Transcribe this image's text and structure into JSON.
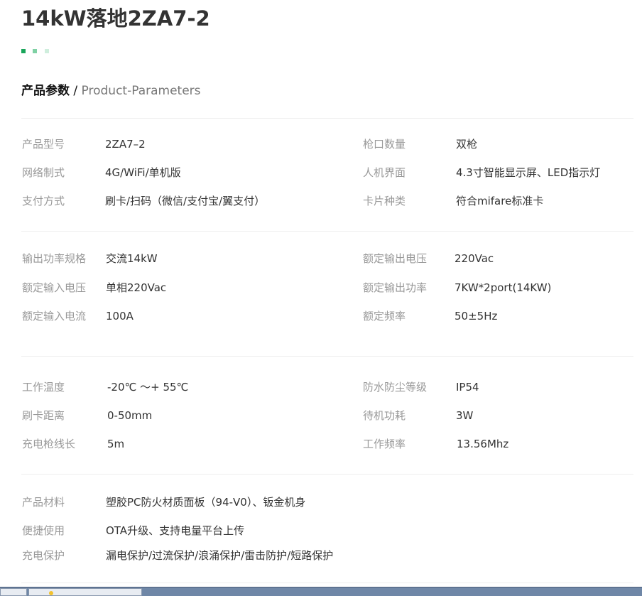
{
  "page": {
    "title": "14kW落地2ZA7-2",
    "accent_colors": [
      "#19a55a",
      "#7fd1a4",
      "#cfeedd"
    ]
  },
  "section": {
    "heading_zh": "产品参数",
    "separator": " / ",
    "heading_en": "Product-Parameters"
  },
  "groups": [
    {
      "rows": [
        {
          "left_label": "产品型号",
          "left_value": "2ZA7–2",
          "right_label": "枪口数量",
          "right_value": "双枪"
        },
        {
          "left_label": "网络制式",
          "left_value": "4G/WiFi/单机版",
          "right_label": "人机界面",
          "right_value": "4.3寸智能显示屏、LED指示灯"
        },
        {
          "left_label": "支付方式",
          "left_value": "刷卡/扫码（微信/支付宝/翼支付）",
          "right_label": "卡片种类",
          "right_value": "符合mifare标准卡"
        }
      ]
    },
    {
      "rows": [
        {
          "left_label": "输出功率规格",
          "left_value": "交流14kW",
          "right_label": "额定输出电压",
          "right_value": "220Vac"
        },
        {
          "left_label": "额定输入电压",
          "left_value": "单相220Vac",
          "right_label": "额定输出功率",
          "right_value": "7KW*2port(14KW)"
        },
        {
          "left_label": "额定输入电流",
          "left_value": "100A",
          "right_label": "额定频率",
          "right_value": "50±5Hz"
        }
      ]
    },
    {
      "rows": [
        {
          "left_label": "工作温度",
          "left_value": "-20℃ ～+ 55℃",
          "right_label": "防水防尘等级",
          "right_value": "IP54"
        },
        {
          "left_label": "刷卡距离",
          "left_value": "0-50mm",
          "right_label": "待机功耗",
          "right_value": "3W"
        },
        {
          "left_label": "充电枪线长",
          "left_value": "5m",
          "right_label": "工作频率",
          "right_value": "13.56Mhz"
        }
      ]
    },
    {
      "rows": [
        {
          "left_label": "产品材料",
          "left_value": "塑胶PC防火材质面板（94-V0）、钣金机身"
        },
        {
          "left_label": "便捷使用",
          "left_value": "OTA升级、支持电量平台上传"
        },
        {
          "left_label": "充电保护",
          "left_value": "漏电保护/过流保护/浪涌保护/雷击防护/短路保护"
        }
      ]
    }
  ],
  "taskbar": {
    "icon": "folder-icon",
    "colors": {
      "bar": "#6f87a7",
      "button": "#e8ecf2",
      "icon": "#f2c12e"
    }
  }
}
